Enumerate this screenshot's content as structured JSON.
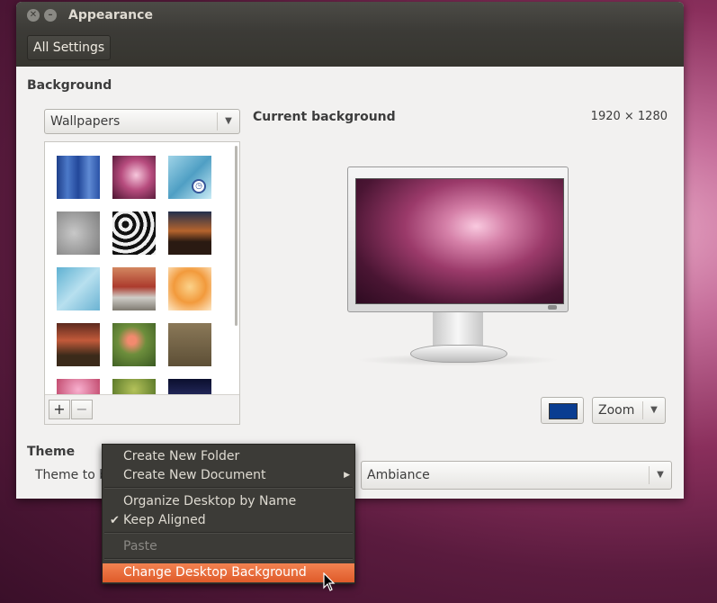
{
  "window": {
    "title": "Appearance",
    "toolbar": {
      "all_settings_label": "All Settings"
    }
  },
  "background": {
    "section_label": "Background",
    "source_combo": {
      "selected": "Wallpapers"
    },
    "current_label": "Current background",
    "resolution": "1920 × 1280",
    "add_label": "+",
    "remove_label": "−",
    "color_swatch": "#0a3d91",
    "placement_combo": {
      "selected": "Zoom"
    }
  },
  "theme": {
    "section_label": "Theme",
    "sub_label": "Theme to b",
    "combo": {
      "selected": "Ambiance"
    }
  },
  "context_menu": {
    "items": [
      {
        "label": "Create New Folder"
      },
      {
        "label": "Create New Document",
        "submenu": true
      },
      {
        "label": "Organize Desktop by Name"
      },
      {
        "label": "Keep Aligned",
        "checked": true
      },
      {
        "label": "Paste",
        "disabled": true
      },
      {
        "label": "Change Desktop Background",
        "highlighted": true
      }
    ]
  },
  "colors": {
    "accent": "#df5b2a",
    "titlebar": "#3c3b37",
    "window_bg": "#f2f1f0"
  }
}
